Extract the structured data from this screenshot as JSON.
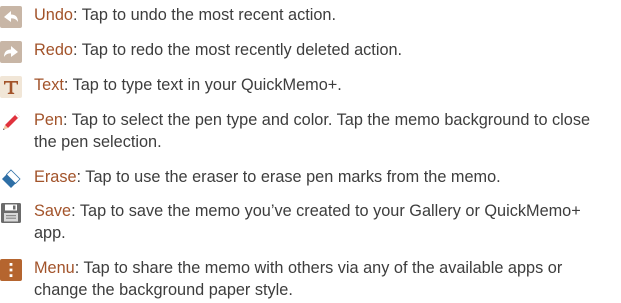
{
  "accent_color": "#a2532a",
  "items": [
    {
      "icon": "undo-icon",
      "term": "Undo",
      "desc": ": Tap to undo the most recent action."
    },
    {
      "icon": "redo-icon",
      "term": "Redo",
      "desc": ": Tap to redo the most recently deleted action."
    },
    {
      "icon": "text-icon",
      "term": "Text",
      "desc": ": Tap to type text in your QuickMemo+."
    },
    {
      "icon": "pen-icon",
      "term": "Pen",
      "desc": ": Tap to select the pen type and color. Tap the memo background to close the pen selection."
    },
    {
      "icon": "eraser-icon",
      "term": "Erase",
      "desc": ": Tap to use the eraser to erase pen marks from the memo."
    },
    {
      "icon": "save-icon",
      "term": "Save",
      "desc": ": Tap to save the memo you’ve created to your Gallery or QuickMemo+ app."
    },
    {
      "icon": "menu-icon",
      "term": "Menu",
      "desc": ": Tap to share the memo with others via any of the available apps or change the background paper style."
    }
  ]
}
